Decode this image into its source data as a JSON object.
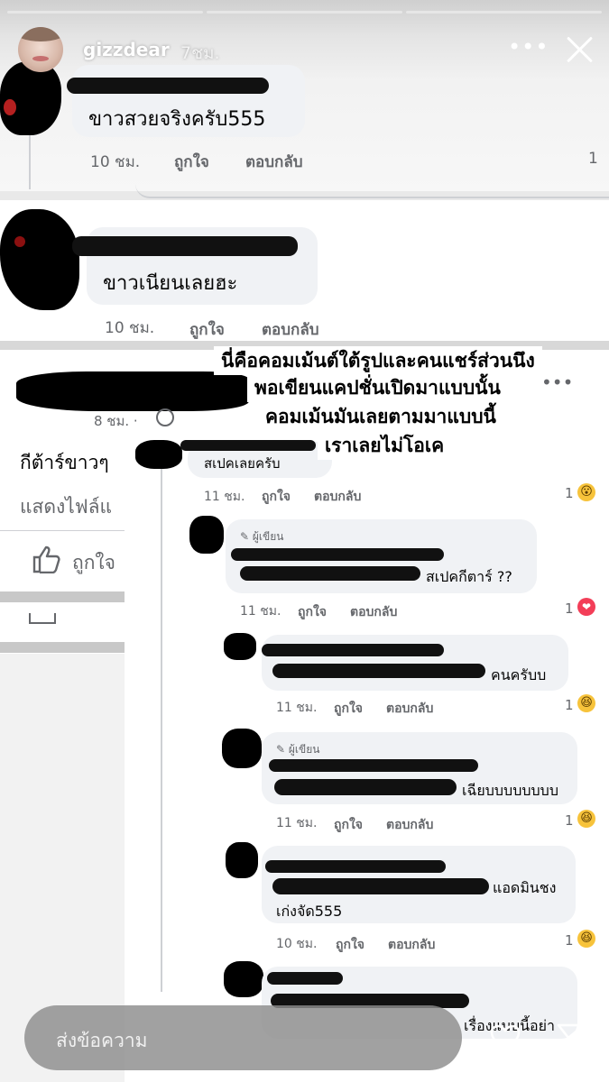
{
  "story": {
    "username": "gizzdear",
    "time": "7ชม.",
    "more_label": "•••",
    "progress_segments": 3,
    "active_segment": 2
  },
  "comments_top": [
    {
      "text": "ขาวสวยจริงครับ555",
      "time": "10 ชม.",
      "like": "ถูกใจ",
      "reply": "ตอบกลับ",
      "count": "1"
    },
    {
      "text": "ขาวเนียนเลยฮะ",
      "time": "10 ชม.",
      "like": "ถูกใจ",
      "reply": "ตอบกลับ"
    }
  ],
  "caption": {
    "lines": [
      "นี่คือคอมเม้นต์ใต้รูปและคนแชร์ส่วนนึง",
      "พอเขียนแคปชั่นเปิดมาแบบนั้น",
      "คอมเม้นมันเลยตามมาแบบนี้",
      "เราเลยไม่โอเค"
    ]
  },
  "left_post": {
    "time": "8 ชม. ·",
    "text": "กีต้าร์ขาวๆ",
    "more": "แสดงไฟล์แ",
    "like": "ถูกใจ"
  },
  "replies": [
    {
      "text": "สเปคเลยครับ",
      "time": "11 ชม.",
      "like": "ถูกใจ",
      "reply": "ตอบกลับ",
      "count": "1",
      "reaction": "😮"
    },
    {
      "author_tag": "ผู้เขียน",
      "text": "สเปคกีตาร์ ??",
      "time": "11 ชม.",
      "like": "ถูกใจ",
      "reply": "ตอบกลับ",
      "count": "1",
      "reaction": "❤"
    },
    {
      "text": "คนครับบ",
      "time": "11 ชม.",
      "like": "ถูกใจ",
      "reply": "ตอบกลับ",
      "count": "1",
      "reaction": "😆"
    },
    {
      "author_tag": "ผู้เขียน",
      "text": "เฉียบบบบบบบบ",
      "time": "11 ชม.",
      "like": "ถูกใจ",
      "reply": "ตอบกลับ",
      "count": "1",
      "reaction": "😆"
    },
    {
      "text_line1": "แอดมินชง",
      "text_line2": "เก่งจัด555",
      "time": "10 ชม.",
      "like": "ถูกใจ",
      "reply": "ตอบกลับ",
      "count": "1",
      "reaction": "😆"
    },
    {
      "text": "เรื่องแบบนี้อย่า"
    }
  ],
  "reply_bar": {
    "placeholder": "ส่งข้อความ"
  }
}
